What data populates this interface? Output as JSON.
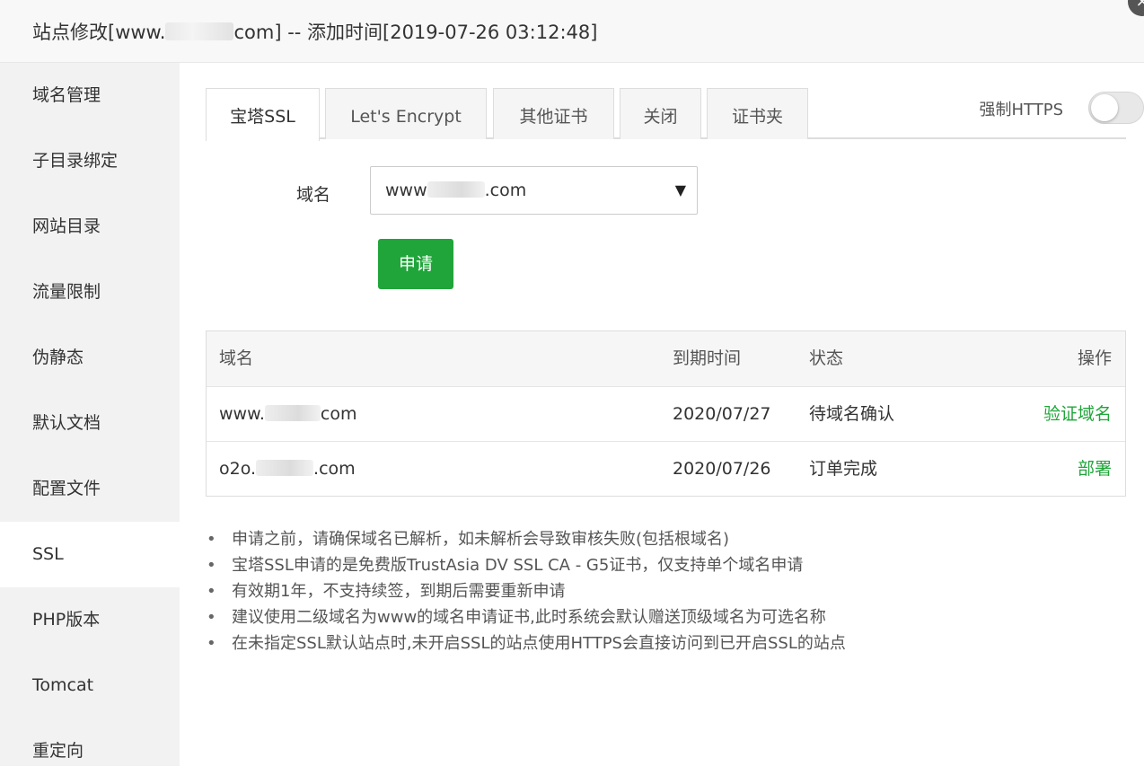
{
  "window": {
    "title_prefix": "站点修改[www.",
    "title_suffix": "com] -- 添加时间[2019-07-26 03:12:48]",
    "close_glyph": "×"
  },
  "sidebar": {
    "items": [
      {
        "label": "域名管理"
      },
      {
        "label": "子目录绑定"
      },
      {
        "label": "网站目录"
      },
      {
        "label": "流量限制"
      },
      {
        "label": "伪静态"
      },
      {
        "label": "默认文档"
      },
      {
        "label": "配置文件"
      },
      {
        "label": "SSL"
      },
      {
        "label": "PHP版本"
      },
      {
        "label": "Tomcat"
      },
      {
        "label": "重定向"
      }
    ],
    "active_index": 7
  },
  "tabs": [
    {
      "label": "宝塔SSL"
    },
    {
      "label": "Let's Encrypt"
    },
    {
      "label": "其他证书"
    },
    {
      "label": "关闭"
    },
    {
      "label": "证书夹"
    }
  ],
  "force_https": {
    "label": "强制HTTPS",
    "enabled": false
  },
  "form": {
    "domain_label": "域名",
    "domain_prefix": "www",
    "domain_suffix": ".com",
    "dropdown_arrow": "▼",
    "apply_label": "申请"
  },
  "table": {
    "headers": {
      "domain": "域名",
      "expire": "到期时间",
      "status": "状态",
      "action": "操作"
    },
    "rows": [
      {
        "domain_prefix": "www.",
        "domain_suffix": "com",
        "expire": "2020/07/27",
        "status": "待域名确认",
        "action": "验证域名"
      },
      {
        "domain_prefix": "o2o.",
        "domain_suffix": ".com",
        "expire": "2020/07/26",
        "status": "订单完成",
        "action": "部署"
      }
    ]
  },
  "tips": [
    "申请之前，请确保域名已解析，如未解析会导致审核失败(包括根域名)",
    "宝塔SSL申请的是免费版TrustAsia DV SSL CA - G5证书，仅支持单个域名申请",
    "有效期1年，不支持续签，到期后需要重新申请",
    "建议使用二级域名为www的域名申请证书,此时系统会默认赠送顶级域名为可选名称",
    "在未指定SSL默认站点时,未开启SSL的站点使用HTTPS会直接访问到已开启SSL的站点"
  ],
  "colors": {
    "accent": "#20a53a",
    "sidebar_bg": "#f2f2f2"
  }
}
